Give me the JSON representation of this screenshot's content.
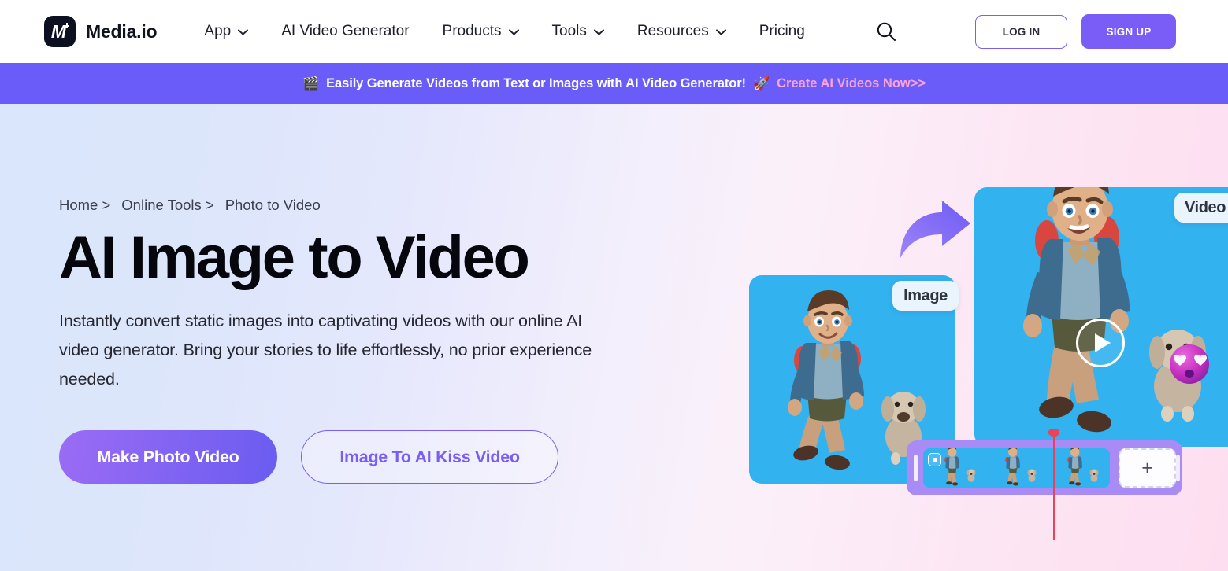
{
  "brand": {
    "name": "Media.io",
    "logo_icon": "media-io-logo-icon"
  },
  "nav": {
    "items": [
      {
        "label": "App",
        "has_dropdown": true
      },
      {
        "label": "AI Video Generator",
        "has_dropdown": false
      },
      {
        "label": "Products",
        "has_dropdown": true
      },
      {
        "label": "Tools",
        "has_dropdown": true
      },
      {
        "label": "Resources",
        "has_dropdown": true
      },
      {
        "label": "Pricing",
        "has_dropdown": false
      }
    ],
    "search_icon": "search-icon",
    "login_label": "LOG IN",
    "signup_label": "SIGN UP"
  },
  "promo": {
    "left_emoji": "🎬",
    "text": "Easily Generate Videos from Text or Images with AI Video Generator!",
    "right_emoji": "🚀",
    "link_label": "Create AI Videos Now>>",
    "background_color": "#6a5cf8",
    "link_color": "#f9a3d8"
  },
  "hero": {
    "breadcrumb": [
      {
        "label": "Home >"
      },
      {
        "label": "Online Tools >"
      },
      {
        "label": "Photo to Video"
      }
    ],
    "title": "AI Image to Video",
    "subtitle": "Instantly convert static images into captivating videos with our online AI video generator. Bring your stories to life effortlessly, no prior experience needed.",
    "cta_primary": "Make Photo Video",
    "cta_secondary": "Image To AI Kiss Video",
    "accent_color": "#7a5cf6"
  },
  "art": {
    "image_badge": "Image",
    "video_badge": "Video",
    "arrow_icon": "curved-arrow-right-icon",
    "play_icon": "play-button-icon",
    "add_clip_label": "+",
    "clip_count": 3,
    "card_background": "#33b2f0",
    "timeline_color": "#a98bf5",
    "playhead_color": "#e8435a"
  }
}
